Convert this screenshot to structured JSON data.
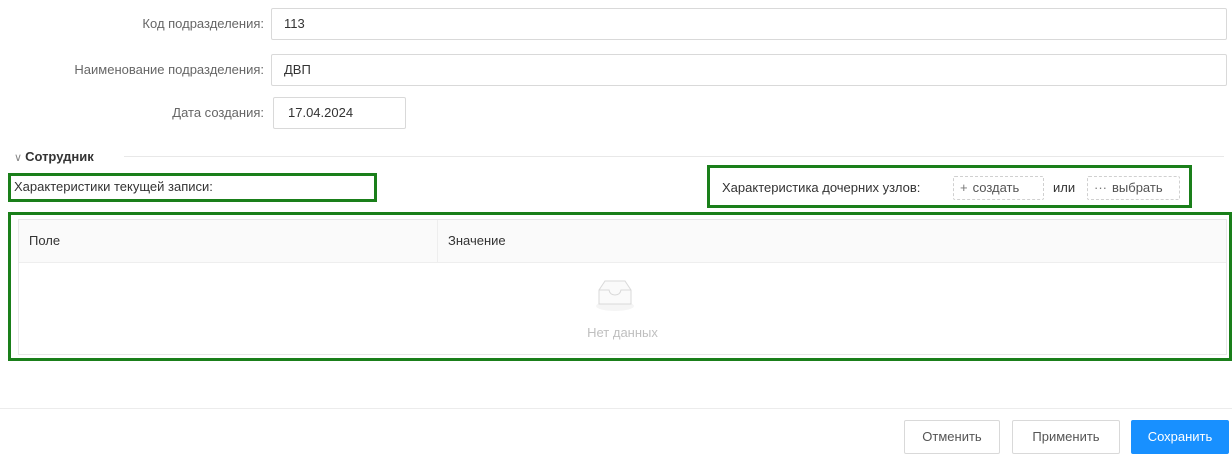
{
  "form": {
    "code_label": "Код подразделения:",
    "code_value": "113",
    "name_label": "Наименование подразделения:",
    "name_value": "ДВП",
    "date_label": "Дата создания:",
    "date_value": "17.04.2024"
  },
  "section": {
    "title": "Сотрудник",
    "current_label": "Характеристики текущей записи:",
    "child_label": "Характеристика дочерних узлов:",
    "create_label": "создать",
    "or_label": "или",
    "select_label": "выбрать"
  },
  "table": {
    "columns": [
      "Поле",
      "Значение"
    ],
    "empty_text": "Нет данных"
  },
  "footer": {
    "cancel_label": "Отменить",
    "apply_label": "Применить",
    "save_label": "Сохранить"
  },
  "colors": {
    "highlight": "#1a7f1a",
    "primary": "#1890ff"
  },
  "icons": {
    "section_toggle": "chevron-down-icon",
    "create": "plus-icon",
    "select": "ellipsis-icon",
    "empty": "inbox-icon"
  }
}
